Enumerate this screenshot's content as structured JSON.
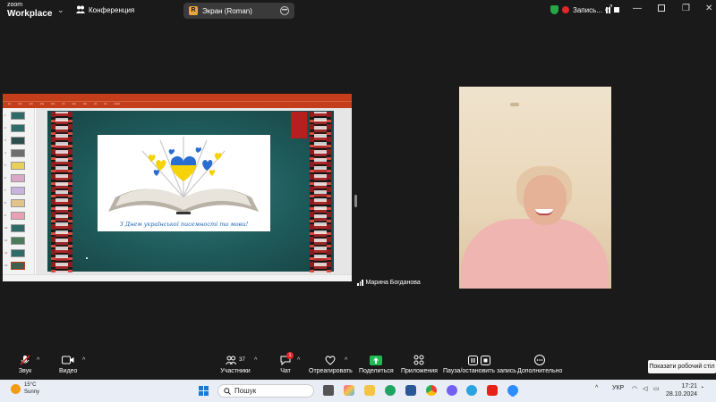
{
  "top": {
    "logo_line1": "zoom",
    "logo_line2": "Workplace",
    "meeting_label": "Конференция",
    "screen_tab_badge": "R",
    "screen_tab_label": "Экран (Roman)",
    "recording_label": "Запись..."
  },
  "share": {
    "slide_caption": "З Днем української писемності та мови!",
    "thumb_numbers": [
      "1",
      "2",
      "3",
      "4",
      "5",
      "6",
      "7",
      "8",
      "9",
      "10",
      "11",
      "12",
      "13"
    ]
  },
  "video": {
    "participant_name": "Марина Богданова"
  },
  "toolbar": {
    "audio_label": "Звук",
    "video_label": "Видео",
    "participants_label": "Участники",
    "participants_count": "37",
    "chat_label": "Чат",
    "chat_badge": "1",
    "react_label": "Отреагировать",
    "share_label": "Поделиться",
    "apps_label": "Приложения",
    "pause_record_label": "Пауза/остановить запись",
    "more_label": "Дополнительно",
    "tooltip": "Показати робочий стіл"
  },
  "taskbar": {
    "temperature": "15°C",
    "weather": "Sunny",
    "search_placeholder": "Пошук",
    "lang": "УКР",
    "time": "17:21",
    "date": "28.10.2024"
  },
  "colors": {
    "ppt_red": "#c43e1c",
    "zoom_bg": "#1a1a1a",
    "share_green": "#1db954",
    "taskbar_bg": "#e9eef6"
  }
}
